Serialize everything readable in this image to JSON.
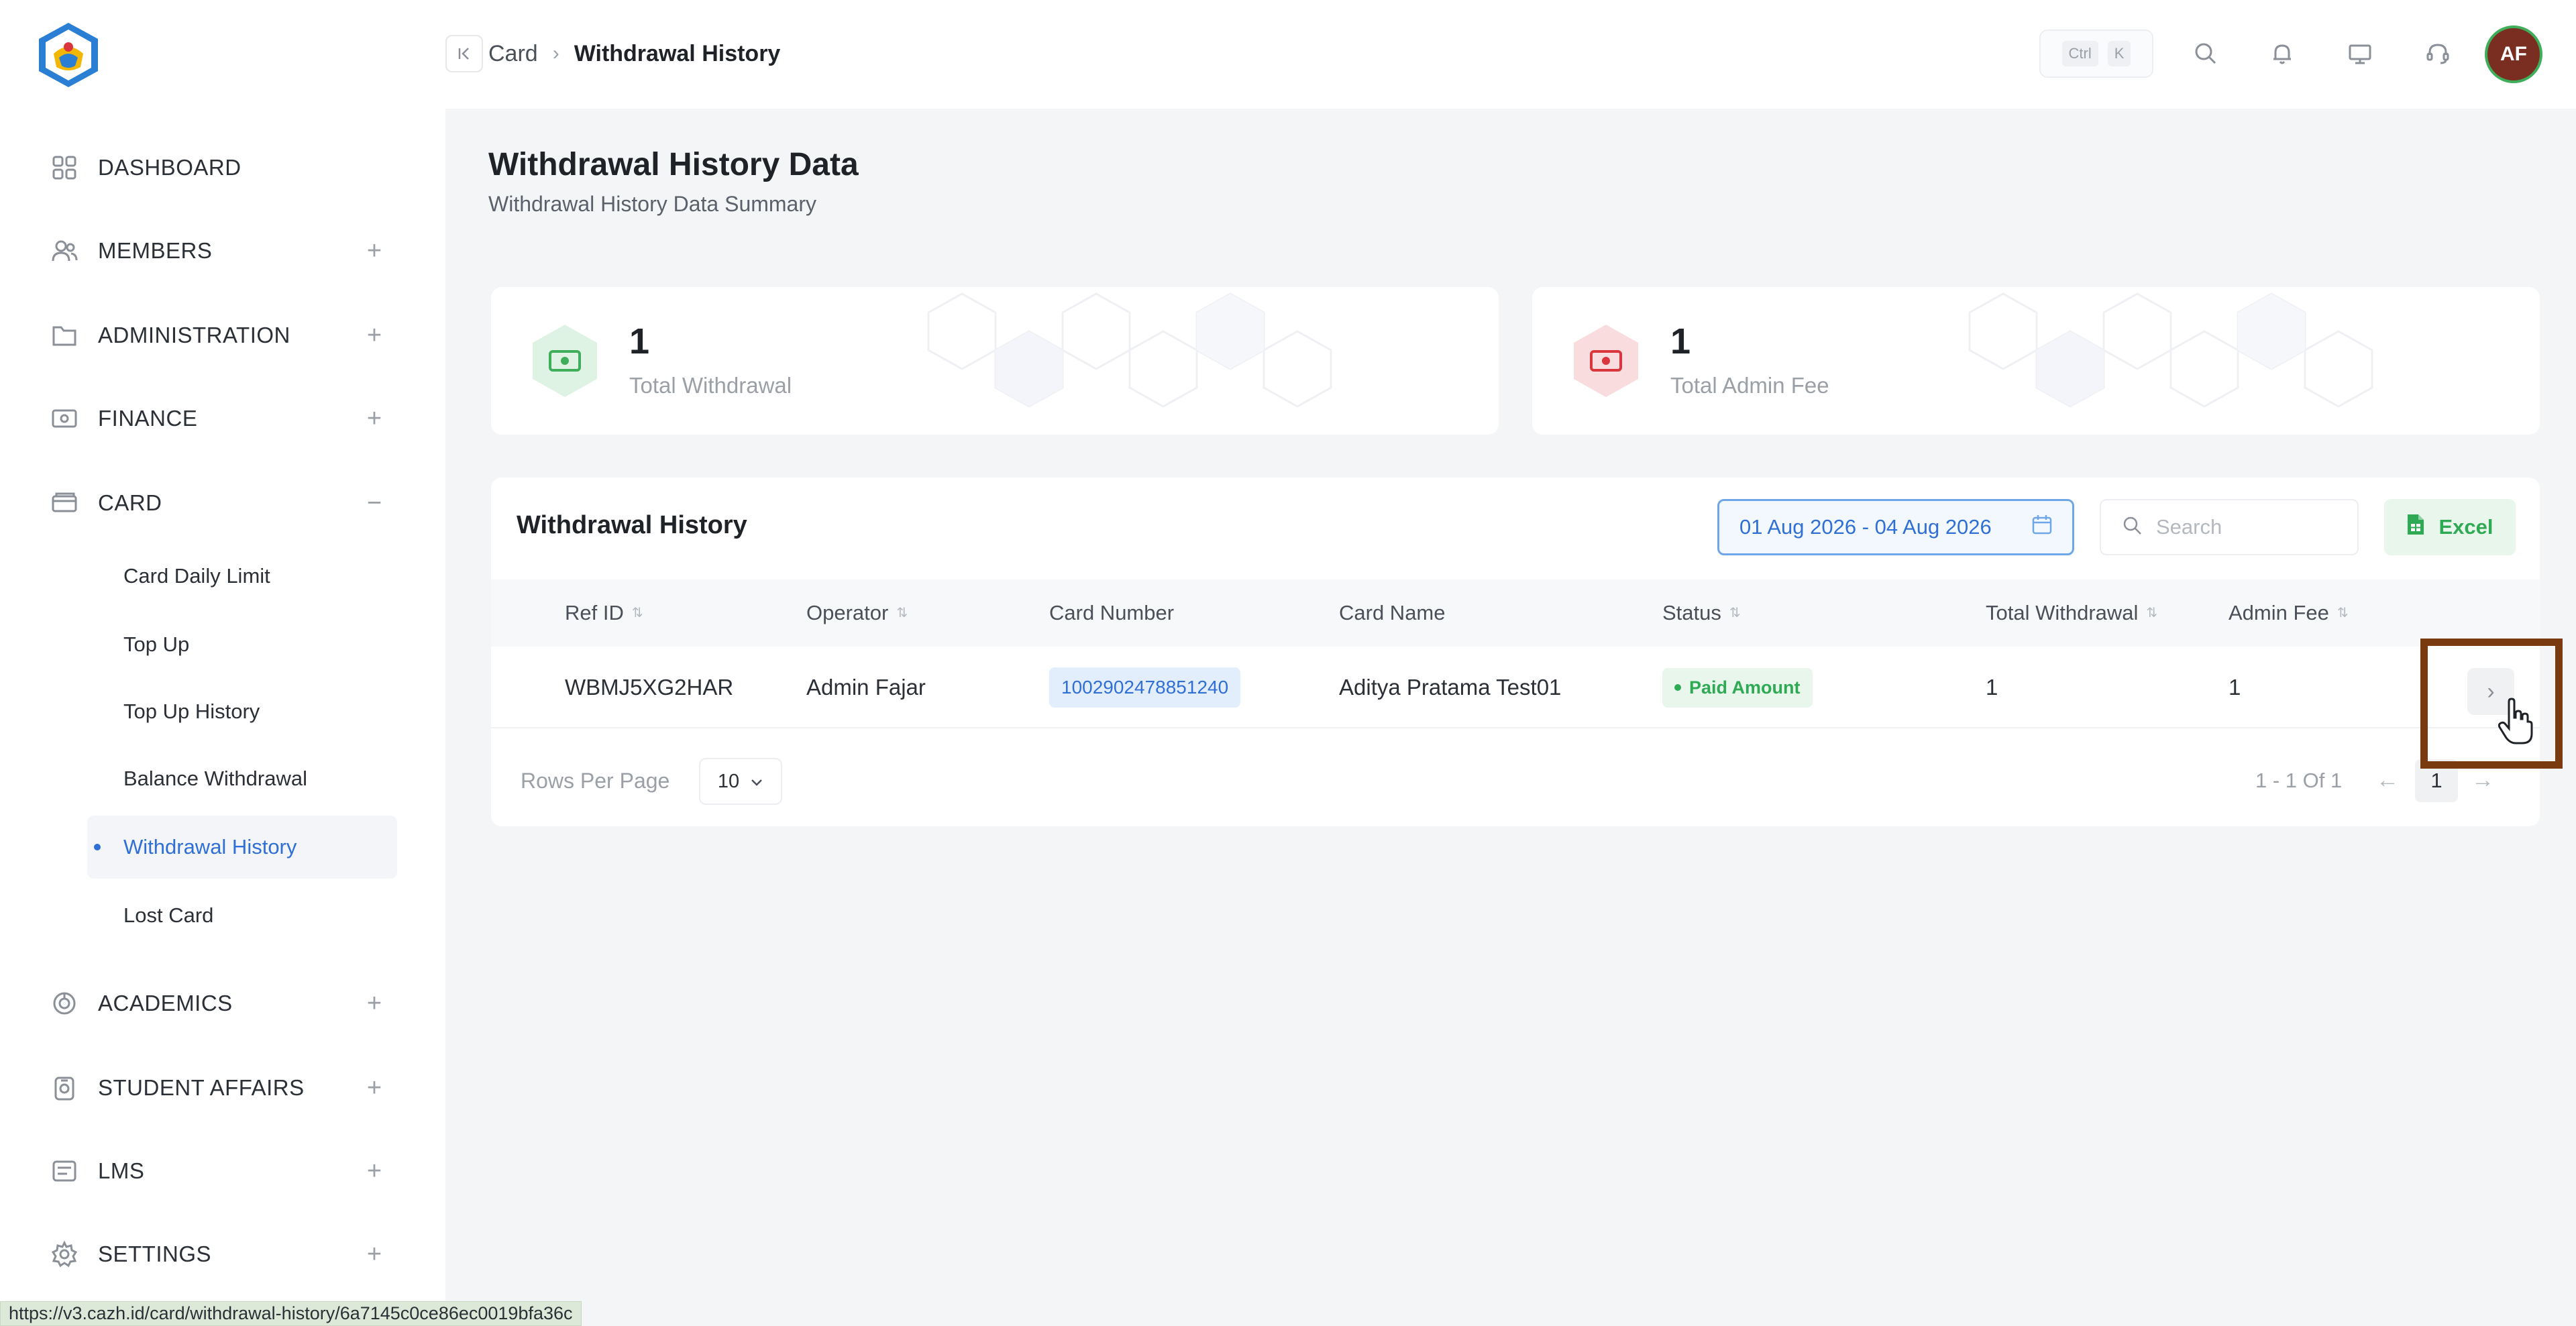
{
  "breadcrumb": {
    "parent": "Card",
    "current": "Withdrawal History"
  },
  "topbar": {
    "kbd_ctrl": "Ctrl",
    "kbd_k": "K",
    "avatar_initials": "AF"
  },
  "sidebar": {
    "items": [
      {
        "label": "DASHBOARD",
        "icon": "grid-icon",
        "expander": ""
      },
      {
        "label": "MEMBERS",
        "icon": "users-icon",
        "expander": "+"
      },
      {
        "label": "ADMINISTRATION",
        "icon": "folder-icon",
        "expander": "+"
      },
      {
        "label": "FINANCE",
        "icon": "money-icon",
        "expander": "+"
      },
      {
        "label": "CARD",
        "icon": "card-icon",
        "expander": "−"
      },
      {
        "label": "ACADEMICS",
        "icon": "academics-icon",
        "expander": "+"
      },
      {
        "label": "STUDENT AFFAIRS",
        "icon": "student-icon",
        "expander": "+"
      },
      {
        "label": "LMS",
        "icon": "lms-icon",
        "expander": "+"
      },
      {
        "label": "SETTINGS",
        "icon": "gear-icon",
        "expander": "+"
      }
    ],
    "card_subitems": [
      "Card Daily Limit",
      "Top Up",
      "Top Up History",
      "Balance Withdrawal",
      "Withdrawal History",
      "Lost Card"
    ],
    "active_subitem": "Withdrawal History"
  },
  "page": {
    "title": "Withdrawal History Data",
    "subtitle": "Withdrawal History Data Summary"
  },
  "stats": [
    {
      "value": "1",
      "label": "Total Withdrawal",
      "color": "#3fae5b"
    },
    {
      "value": "1",
      "label": "Total Admin Fee",
      "color": "#d9363e"
    }
  ],
  "table": {
    "title": "Withdrawal History",
    "date_range": "01 Aug 2026 - 04 Aug 2026",
    "search_placeholder": "Search",
    "excel_label": "Excel",
    "columns": [
      "Ref ID",
      "Operator",
      "Card Number",
      "Card Name",
      "Status",
      "Total Withdrawal",
      "Admin Fee"
    ],
    "rows": [
      {
        "ref_id": "WBMJ5XG2HAR",
        "operator": "Admin Fajar",
        "card_number": "1002902478851240",
        "card_name": "Aditya Pratama Test01",
        "status": "Paid Amount",
        "total_withdrawal": "1",
        "admin_fee": "1"
      }
    ],
    "rows_per_page_label": "Rows Per Page",
    "rows_per_page": "10",
    "pager_info": "1 - 1 Of 1",
    "current_page": "1"
  },
  "status_url": "https://v3.cazh.id/card/withdrawal-history/6a7145c0ce86ec0019bfa36c",
  "colors": {
    "accent": "#2f6fd6",
    "success": "#2eaa55",
    "danger": "#d9363e",
    "highlight": "#7a3a10"
  }
}
